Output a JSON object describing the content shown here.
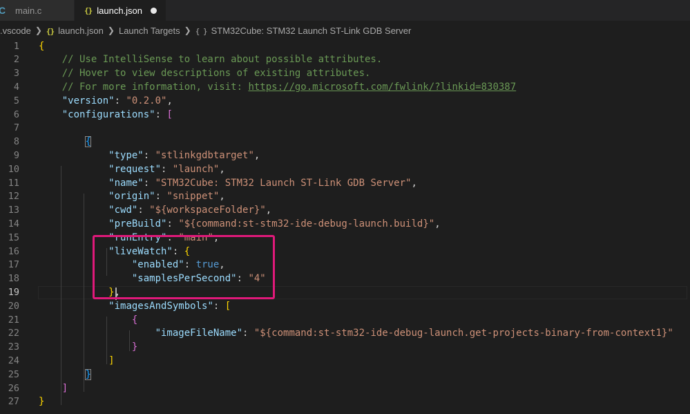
{
  "tabs": [
    {
      "icon": "c-file-icon",
      "icon_glyph": "C",
      "label": "main.c",
      "active": false
    },
    {
      "icon": "json-file-icon",
      "icon_glyph": "{}",
      "label": "launch.json",
      "active": true,
      "dirty": true
    }
  ],
  "breadcrumb": [
    {
      "label": ".vscode",
      "icon": null
    },
    {
      "label": "launch.json",
      "icon": "{}"
    },
    {
      "label": "Launch Targets",
      "icon": null
    },
    {
      "label": "STM32Cube: STM32 Launch ST-Link GDB Server",
      "icon": "{ }"
    }
  ],
  "editor": {
    "active_line": 19,
    "line_numbers": [
      "1",
      "2",
      "3",
      "4",
      "5",
      "6",
      "7",
      "8",
      "9",
      "10",
      "11",
      "12",
      "13",
      "14",
      "15",
      "16",
      "17",
      "18",
      "19",
      "20",
      "21",
      "22",
      "23",
      "24",
      "25",
      "26",
      "27"
    ],
    "lines": [
      [
        {
          "t": "{",
          "c": "br1"
        }
      ],
      [
        {
          "t": "    // Use IntelliSense to learn about possible attributes.",
          "c": "cm"
        }
      ],
      [
        {
          "t": "    // Hover to view descriptions of existing attributes.",
          "c": "cm"
        }
      ],
      [
        {
          "t": "    // For more information, visit: ",
          "c": "cm"
        },
        {
          "t": "https://go.microsoft.com/fwlink/?linkid=830387",
          "c": "lk"
        }
      ],
      [
        {
          "t": "    ",
          "c": "p"
        },
        {
          "t": "\"version\"",
          "c": "k"
        },
        {
          "t": ": ",
          "c": "p"
        },
        {
          "t": "\"0.2.0\"",
          "c": "s"
        },
        {
          "t": ",",
          "c": "p"
        }
      ],
      [
        {
          "t": "    ",
          "c": "p"
        },
        {
          "t": "\"configurations\"",
          "c": "k"
        },
        {
          "t": ": ",
          "c": "p"
        },
        {
          "t": "[",
          "c": "br2"
        }
      ],
      [],
      [
        {
          "t": "        ",
          "c": "p"
        },
        {
          "t": "{",
          "c": "br3 bm"
        }
      ],
      [
        {
          "t": "            ",
          "c": "p"
        },
        {
          "t": "\"type\"",
          "c": "k"
        },
        {
          "t": ": ",
          "c": "p"
        },
        {
          "t": "\"stlinkgdbtarget\"",
          "c": "s"
        },
        {
          "t": ",",
          "c": "p"
        }
      ],
      [
        {
          "t": "            ",
          "c": "p"
        },
        {
          "t": "\"request\"",
          "c": "k"
        },
        {
          "t": ": ",
          "c": "p"
        },
        {
          "t": "\"launch\"",
          "c": "s"
        },
        {
          "t": ",",
          "c": "p"
        }
      ],
      [
        {
          "t": "            ",
          "c": "p"
        },
        {
          "t": "\"name\"",
          "c": "k"
        },
        {
          "t": ": ",
          "c": "p"
        },
        {
          "t": "\"STM32Cube: STM32 Launch ST-Link GDB Server\"",
          "c": "s"
        },
        {
          "t": ",",
          "c": "p"
        }
      ],
      [
        {
          "t": "            ",
          "c": "p"
        },
        {
          "t": "\"origin\"",
          "c": "k"
        },
        {
          "t": ": ",
          "c": "p"
        },
        {
          "t": "\"snippet\"",
          "c": "s"
        },
        {
          "t": ",",
          "c": "p"
        }
      ],
      [
        {
          "t": "            ",
          "c": "p"
        },
        {
          "t": "\"cwd\"",
          "c": "k"
        },
        {
          "t": ": ",
          "c": "p"
        },
        {
          "t": "\"${workspaceFolder}\"",
          "c": "s"
        },
        {
          "t": ",",
          "c": "p"
        }
      ],
      [
        {
          "t": "            ",
          "c": "p"
        },
        {
          "t": "\"preBuild\"",
          "c": "k"
        },
        {
          "t": ": ",
          "c": "p"
        },
        {
          "t": "\"${command:st-stm32-ide-debug-launch.build}\"",
          "c": "s"
        },
        {
          "t": ",",
          "c": "p"
        }
      ],
      [
        {
          "t": "            ",
          "c": "p"
        },
        {
          "t": "\"runEntry\"",
          "c": "k"
        },
        {
          "t": ": ",
          "c": "p"
        },
        {
          "t": "\"main\"",
          "c": "s"
        },
        {
          "t": ",",
          "c": "p"
        }
      ],
      [
        {
          "t": "            ",
          "c": "p"
        },
        {
          "t": "\"liveWatch\"",
          "c": "k"
        },
        {
          "t": ": ",
          "c": "p"
        },
        {
          "t": "{",
          "c": "br1"
        }
      ],
      [
        {
          "t": "                ",
          "c": "p"
        },
        {
          "t": "\"enabled\"",
          "c": "k"
        },
        {
          "t": ": ",
          "c": "p"
        },
        {
          "t": "true",
          "c": "b"
        },
        {
          "t": ",",
          "c": "p"
        }
      ],
      [
        {
          "t": "                ",
          "c": "p"
        },
        {
          "t": "\"samplesPerSecond\"",
          "c": "k"
        },
        {
          "t": ": ",
          "c": "p"
        },
        {
          "t": "\"4\"",
          "c": "s"
        }
      ],
      [
        {
          "t": "            ",
          "c": "p"
        },
        {
          "t": "}",
          "c": "br1"
        },
        {
          "t": ",",
          "c": "p"
        }
      ],
      [
        {
          "t": "            ",
          "c": "p"
        },
        {
          "t": "\"imagesAndSymbols\"",
          "c": "k"
        },
        {
          "t": ": ",
          "c": "p"
        },
        {
          "t": "[",
          "c": "br1"
        }
      ],
      [
        {
          "t": "                ",
          "c": "p"
        },
        {
          "t": "{",
          "c": "br2"
        }
      ],
      [
        {
          "t": "                    ",
          "c": "p"
        },
        {
          "t": "\"imageFileName\"",
          "c": "k"
        },
        {
          "t": ": ",
          "c": "p"
        },
        {
          "t": "\"${command:st-stm32-ide-debug-launch.get-projects-binary-from-context1}\"",
          "c": "s"
        }
      ],
      [
        {
          "t": "                ",
          "c": "p"
        },
        {
          "t": "}",
          "c": "br2"
        }
      ],
      [
        {
          "t": "            ",
          "c": "p"
        },
        {
          "t": "]",
          "c": "br1"
        }
      ],
      [
        {
          "t": "        ",
          "c": "p"
        },
        {
          "t": "}",
          "c": "br3 bm"
        }
      ],
      [
        {
          "t": "    ",
          "c": "p"
        },
        {
          "t": "]",
          "c": "br2"
        }
      ],
      [
        {
          "t": "}",
          "c": "br1"
        }
      ]
    ]
  },
  "colors": {
    "background": "#1e1e1e",
    "tab_bar": "#252526",
    "highlight_box": "#e0197a",
    "string": "#ce9178",
    "key": "#9cdcfe",
    "comment": "#6a9955",
    "boolean": "#569cd6"
  }
}
